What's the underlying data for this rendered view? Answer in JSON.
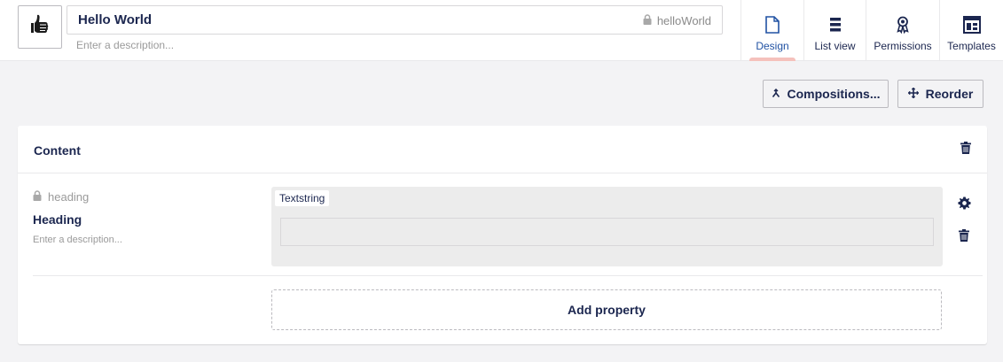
{
  "header": {
    "name": "Hello World",
    "alias": "helloWorld",
    "description_placeholder": "Enter a description..."
  },
  "apps": [
    {
      "label": "Design",
      "icon": "document-icon",
      "active": true
    },
    {
      "label": "List view",
      "icon": "list-view-icon",
      "active": false
    },
    {
      "label": "Permissions",
      "icon": "permissions-icon",
      "active": false
    },
    {
      "label": "Templates",
      "icon": "templates-icon",
      "active": false
    }
  ],
  "toolbar": {
    "compositions_label": "Compositions...",
    "reorder_label": "Reorder"
  },
  "group": {
    "title": "Content",
    "property": {
      "alias": "heading",
      "name": "Heading",
      "description_placeholder": "Enter a description...",
      "editor": "Textstring"
    },
    "add_property_label": "Add property"
  },
  "colors": {
    "text": "#1b264f",
    "active_link": "#2152a3",
    "active_indicator": "#f5c1bc",
    "background": "#f3f3f5"
  }
}
